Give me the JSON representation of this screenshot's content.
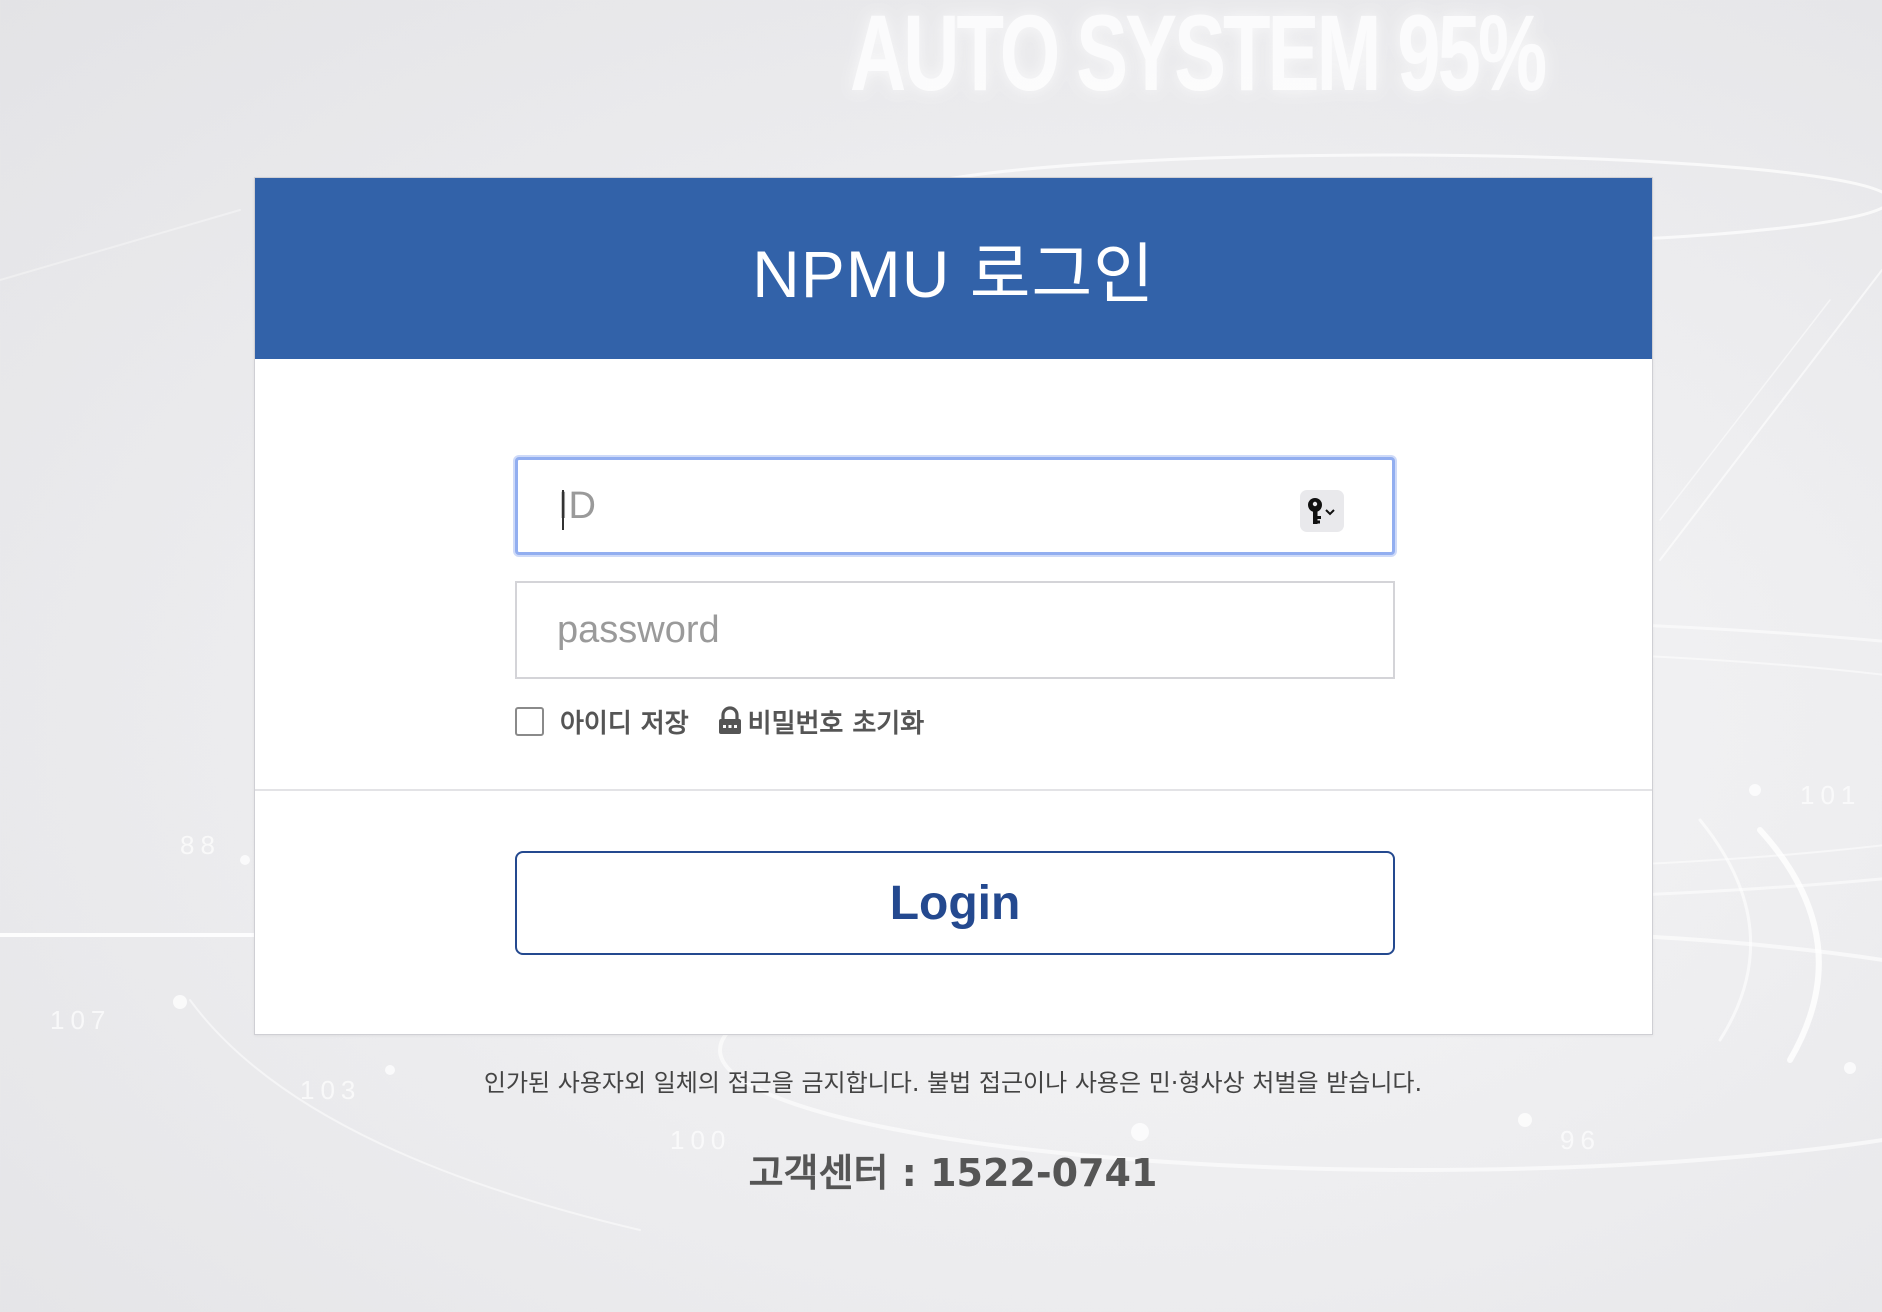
{
  "colors": {
    "brand": "#3262a9",
    "brand_dark": "#24498f",
    "focus_ring": "#92aef0",
    "background": "#eeeef0"
  },
  "background": {
    "headline": "AUTO SYSTEM 95%",
    "ticks": [
      "107",
      "103",
      "100",
      "96",
      "101",
      "88"
    ]
  },
  "login_panel": {
    "title": "NPMU 로그인",
    "id_field": {
      "placeholder": "ID",
      "value": "",
      "focused": true,
      "autofill_icon": "key-icon"
    },
    "password_field": {
      "placeholder": "password",
      "value": ""
    },
    "save_id": {
      "label": "아이디 저장",
      "checked": false
    },
    "reset_password": {
      "icon": "lock-icon",
      "label": "비밀번호 초기화"
    },
    "login_button": {
      "label": "Login"
    }
  },
  "footer": {
    "notice": "인가된 사용자외 일체의 접근을 금지합니다. 불법 접근이나 사용은 민·형사상 처벌을 받습니다.",
    "support": "고객센터 : 1522-0741"
  }
}
